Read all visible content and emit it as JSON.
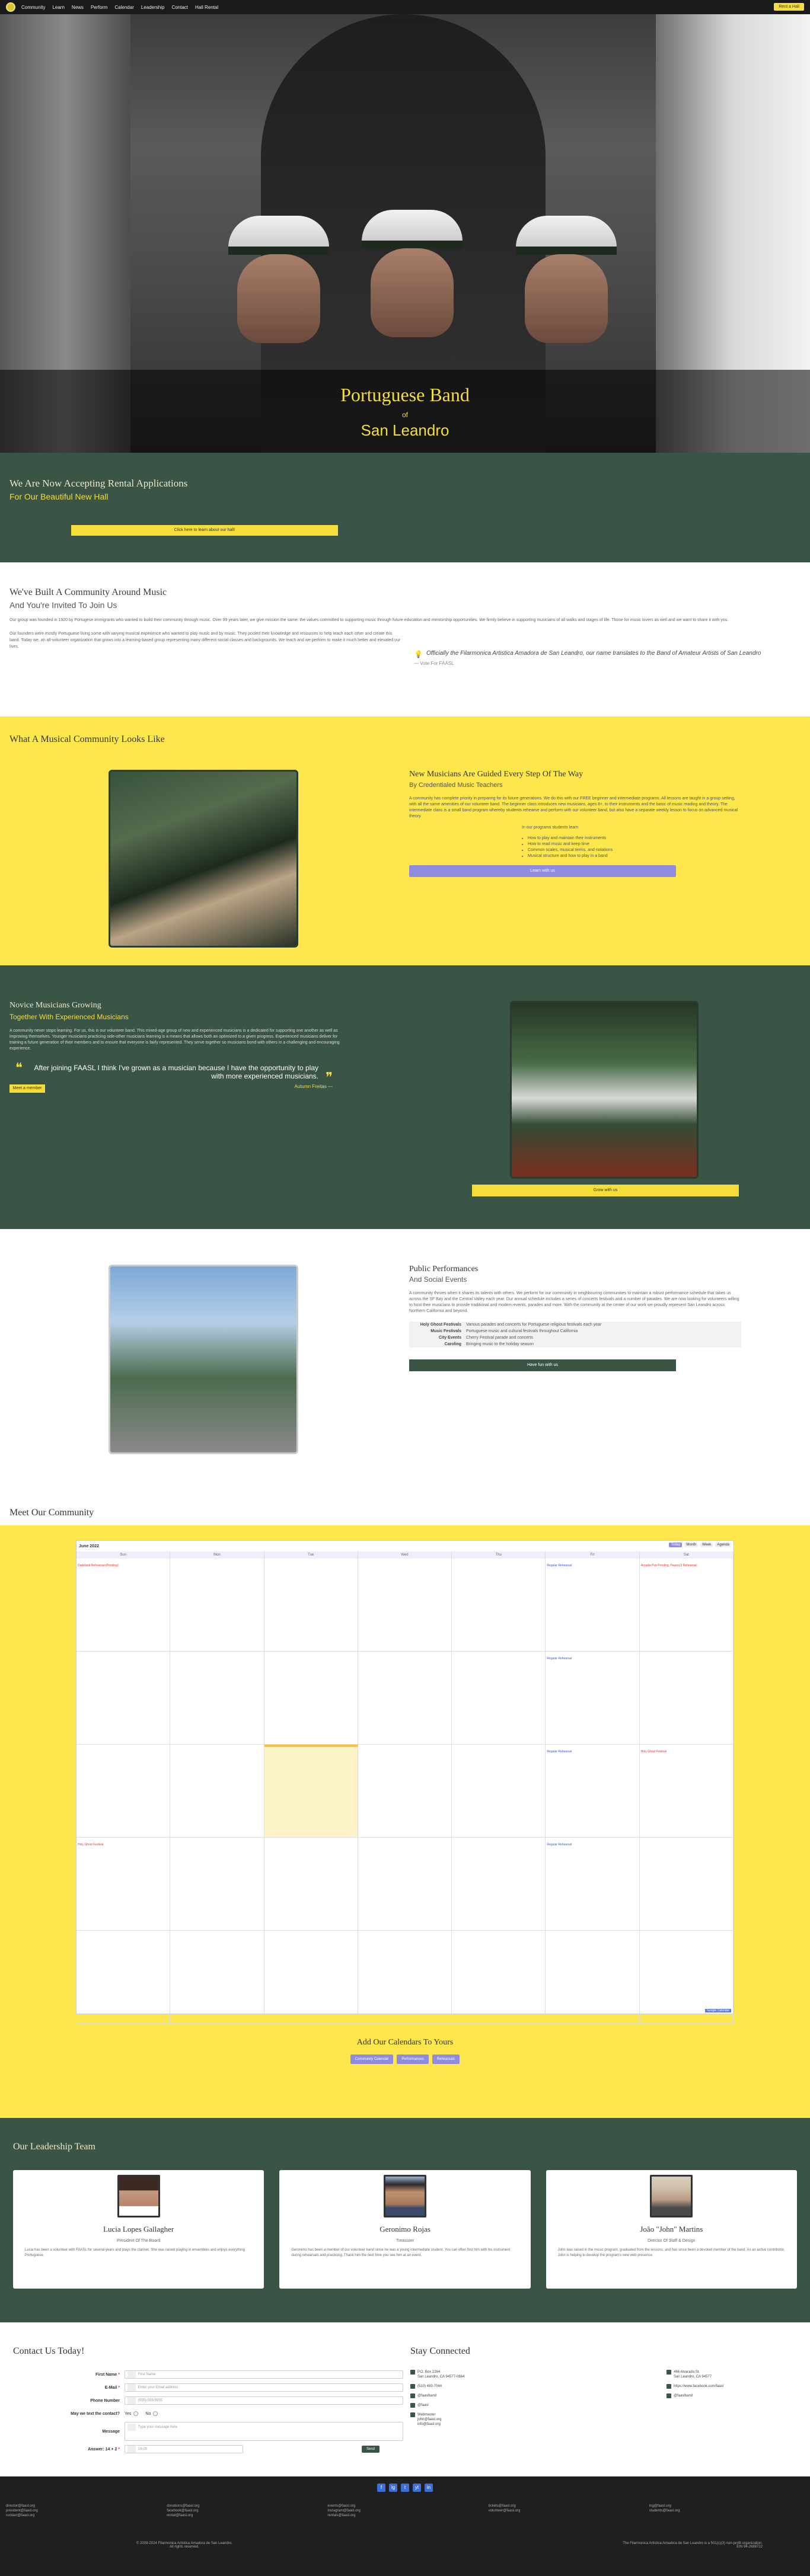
{
  "nav": {
    "links": [
      "Community",
      "Learn",
      "News",
      "Perform",
      "Calendar",
      "Leadership",
      "Contact",
      "Hall Rental"
    ],
    "rent_button": "Rent a Hall"
  },
  "hero": {
    "title": "Portuguese Band",
    "of": "of",
    "city": "San Leandro"
  },
  "rental": {
    "heading": "We Are Now Accepting Rental Applications",
    "subheading": "For Our Beautiful New Hall",
    "button": "Click here to learn about our hall!"
  },
  "community": {
    "heading": "We've Built A Community Around Music",
    "subheading": "And You're Invited To Join Us",
    "p1": "Our group was founded in 1920 by Portugese immigrants who wanted to build their community through music. Over 99 years later, we give mission the same: the values committed to supporting music through future education and mentorship opportunities. We firmly believe in supporting musicians of all walks and stages of life. Those for music lovers as well and we want to share it with you.",
    "p2": "Our founders were mostly Portuguese living some with varying musical experience who wanted to play music and by music. They pooled their knowledge and resources to help teach each other and create this band. Today we, an all-volunteer organization that grows into a learning-based group representing many different social classes and backgrounds. We teach and we perform to make it much better and elevated our lives.",
    "quote": "Officially the Filarmonica Artistica Amadora de San Leandro, our name translates to the Band of Amateur Artists of San Leandro",
    "quote_by": "— Vote For FAASL"
  },
  "looks_like": {
    "heading": "What A Musical Community Looks Like",
    "col_heading": "New Musicians Are Guided Every Step Of The Way",
    "col_subheading": "By Credentialed Music Teachers",
    "p": "A community has complete priority in preparing for its future generations. We do this with our FREE beginner and intermediate programs. All lessons are taught in a group setting, with all the same amenities of our volunteer band. The beginner class introduces new musicians, ages 8+, to their instruments and the basic of music reading and theory. The intermediate class is a small band program whereby students rehearse and perform with our volunteer band, but also have a separate weekly lesson to focus on advanced musical theory.",
    "list_intro": "In our programs students learn",
    "list": [
      "How to play and maintain their instruments",
      "How to read music and keep time",
      "Common scales, musical terms, and notations",
      "Musical structure and how to play in a band"
    ],
    "button": "Learn with us"
  },
  "growing": {
    "heading": "Novice Musicians Growing",
    "subheading": "Together With Experienced Musicians",
    "p": "A community never stops learning. For us, this is our volunteer band. This mixed-age group of new and experienced musicians is a dedicated for supporting one another as well as improving themselves. Younger musicians practicing side-other musicians learning is a means that allows both an optimized to a given progress. Experienced musicians deliver for training a future generation of their members and to ensure that everyone is fairly represented. They serve together so musicians bond with others in a challenging and encouraging experience.",
    "quote": "After joining FAASL I think I've grown as a musician because I have the opportunity to play with more experienced musicians.",
    "quote_by": "Autumn Freitas",
    "small_button": "Meet a member",
    "button": "Grow with us"
  },
  "perform": {
    "heading": "Public Performances",
    "subheading": "And Social Events",
    "p": "A community thrives when it shares its talents with others. We perform for our community in neighbouring communities to maintain a robust performance schedule that takes us across the SF Bay and the Central Valley each year. Our annual schedule includes a series of concerts festivals and a number of parades. We are now looking for volunteers willing to host their musicians to provide traditional and modern events, parades and more. With the community at the center of our work we proudly represent San Leandro across Northern California and beyond.",
    "table": [
      {
        "k": "Holy Ghost Festivals",
        "v": "Various parades and concerts for Portuguese religious festivals each year"
      },
      {
        "k": "Music Festivals",
        "v": "Portuguese music and cultural festivals throughout California"
      },
      {
        "k": "City Events",
        "v": "Cherry Festival parade and concerts"
      },
      {
        "k": "Caroling",
        "v": "Bringing music to the holiday season"
      }
    ],
    "button": "Have fun with us"
  },
  "calendar": {
    "heading": "Meet Our Community",
    "title": "June 2022",
    "controls": [
      "Today",
      "Month",
      "Week",
      "Agenda"
    ],
    "dows": [
      "Sun",
      "Mon",
      "Tue",
      "Wed",
      "Thu",
      "Fri",
      "Sat"
    ],
    "events": {
      "0": "Dadeland Rehearsal (Pending)",
      "5": "Regular Rehearsal",
      "6": "Arcadia Pub Pending, Paseo(J) Rehearsal",
      "12": "Regular Rehearsal",
      "19": "Regular Rehearsal",
      "20": "Holy Ghost Festival",
      "21": "Holy Ghost Festival",
      "26": "Regular Rehearsal"
    },
    "footer": "Google Calendar",
    "add_heading": "Add Our Calendars To Yours",
    "add_buttons": [
      "Community Calendar",
      "Performances",
      "Rehearsals"
    ]
  },
  "leadership": {
    "heading": "Our Leadership Team",
    "people": [
      {
        "name": "Lucia Lopes Gallagher",
        "role": "President Of The Board",
        "bio": "Lucia has been a volunteer with FAASL for several years and plays the clarinet. She was raised playing in ensembles and enjoys everything Portuguese."
      },
      {
        "name": "Geronimo Rojas",
        "role": "Treasurer",
        "bio": "Geronimo has been a member of our volunteer band since he was a young intermediate student. You can often find him with his instrument during rehearsals and practicing. Thank him the next time you see him at an event."
      },
      {
        "name": "João \"John\" Martins",
        "role": "Director Of Staff & Design",
        "bio": "John was raised in the music program, graduated from the lessons, and has since been a devoted member of the band. As an active contributor, John is helping to develop the program's new web presence."
      }
    ]
  },
  "contact": {
    "heading": "Contact Us Today!",
    "fields": [
      {
        "label": "First Name",
        "placeholder": "First Name",
        "required": true
      },
      {
        "label": "E-Mail",
        "placeholder": "Enter your Email address",
        "required": true
      },
      {
        "label": "Phone Number",
        "placeholder": "(555) 555-5555",
        "required": false
      }
    ],
    "contact_label": "May we text the contact?",
    "contact_yes": "Yes",
    "contact_no": "No",
    "message_label": "Message",
    "message_placeholder": "Type your message here",
    "answer_label": "Answer: 14 + 2",
    "answer_placeholder": "16-20",
    "submit": "Send"
  },
  "stay": {
    "heading": "Stay Connected",
    "items": [
      "P.O. Box 2264\nSan Leandro, CA 94577-0664",
      "466 Alvarado St.\nSan Leandro, CA 94577",
      "(510) 483-7044",
      "https://www.facebook.com/faasl",
      "@faaslband",
      "@faaslband",
      "@faasl",
      "Webmaster\njohn@faasl.org\ninfo@faasl.org"
    ]
  },
  "footer": {
    "social": [
      "f",
      "ig",
      "t",
      "yt",
      "in"
    ],
    "cols": [
      [
        "director@faasl.org",
        "president@faasl.org",
        "contact@faasl.org"
      ],
      [
        "donations@faasl.org",
        "facebook@faasl.org",
        "rental@faasl.org"
      ],
      [
        "events@faasl.org",
        "instagram@faasl.org",
        "rentals@faasl.org"
      ],
      [
        "tickets@faasl.org",
        "volunteer@faasl.org"
      ],
      [
        "ing@faasl.org",
        "students@faasl.org"
      ]
    ],
    "copyright": "© 2009-2024 Filarmonica Artistica Amadora de San Leandro.\nAll rights reserved.",
    "notice": "The Filarmonica Artistica Amadora de San Leandro is a 501(c)(3) non-profit organization.\nEIN 94-2688722"
  }
}
